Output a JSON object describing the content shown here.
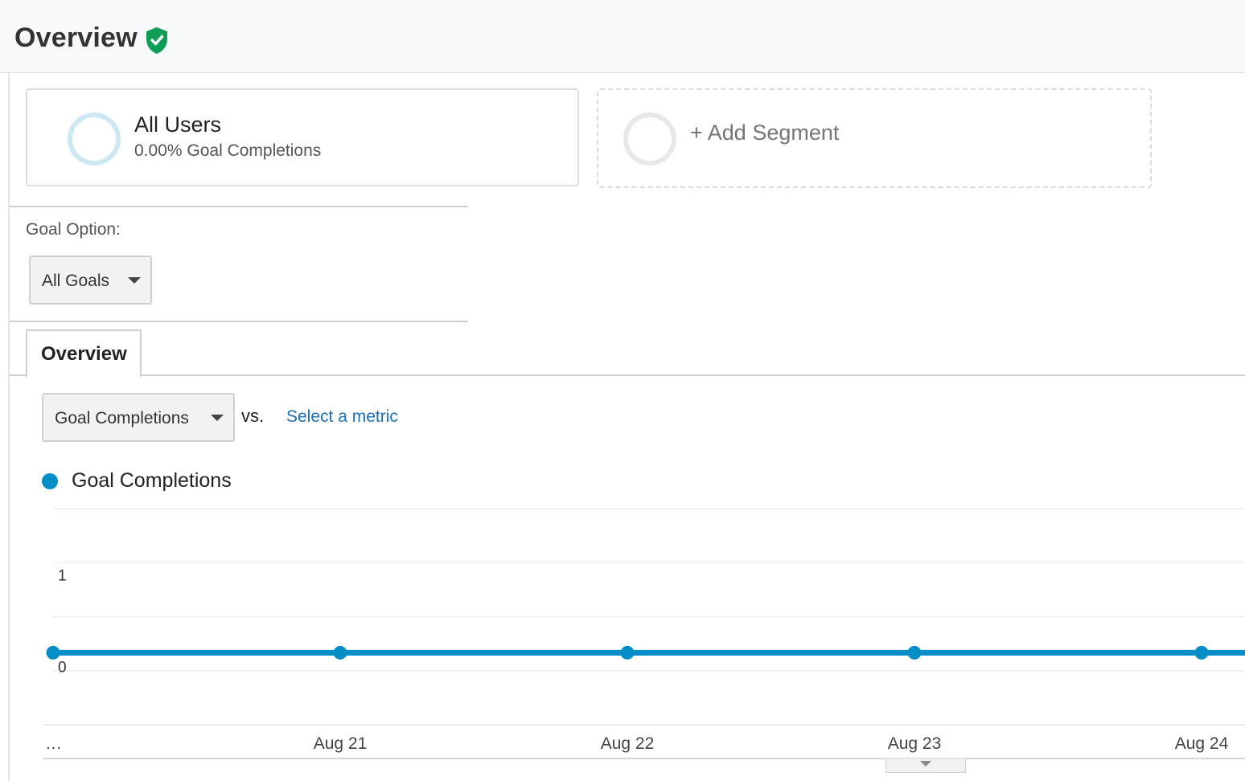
{
  "header": {
    "title": "Overview"
  },
  "segments": {
    "primary": {
      "name": "All Users",
      "summary": "0.00% Goal Completions"
    },
    "add_label": "+ Add Segment"
  },
  "goal_option": {
    "label": "Goal Option:",
    "selected": "All Goals"
  },
  "tabs": [
    {
      "label": "Overview",
      "active": true
    }
  ],
  "metric_picker": {
    "selected": "Goal Completions",
    "vs_label": "vs.",
    "secondary_placeholder": "Select a metric"
  },
  "colors": {
    "series": "#058dc7",
    "link": "#1a6fb6",
    "verified": "#0f9d58"
  },
  "chart_data": {
    "type": "line",
    "x": [
      "…",
      "Aug 21",
      "Aug 22",
      "Aug 23",
      "Aug 24"
    ],
    "series": [
      {
        "name": "Goal Completions",
        "values": [
          0,
          0,
          0,
          0,
          0
        ]
      }
    ],
    "ylim": [
      -1,
      2
    ],
    "y_tick_labels": [
      "1",
      "0"
    ],
    "y_tick_values": [
      1,
      0
    ],
    "grid": true,
    "legend": "top-left",
    "marker": "circle"
  }
}
